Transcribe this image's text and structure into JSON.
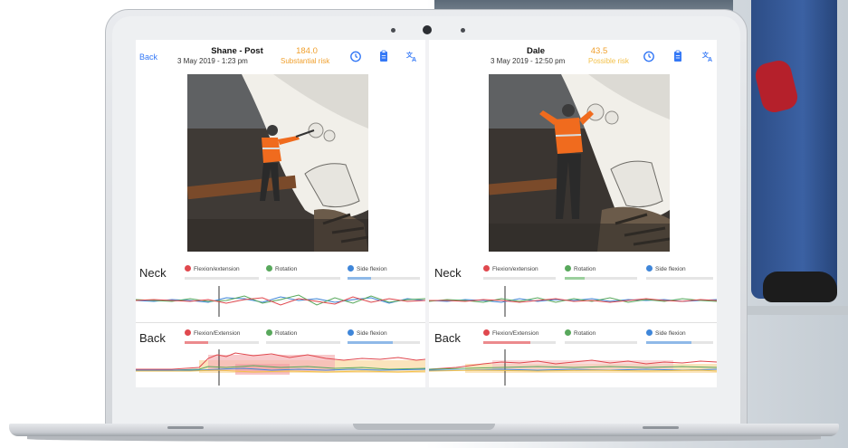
{
  "colors": {
    "accent": "#3478f6",
    "risk_high": "#f0a02e",
    "risk_low": "#f3c14a",
    "flexion": "#e0484e",
    "rotation": "#58a85c",
    "side_flexion": "#3f86d9"
  },
  "left": {
    "back_label": "Back",
    "name": "Shane - Post",
    "date": "3 May 2019 - 1:23 pm",
    "score": "184.0",
    "risk": "Substantial risk",
    "icons": [
      "timer-icon",
      "clipboard-icon",
      "translate-icon"
    ],
    "neck": {
      "title": "Neck",
      "legend": [
        "Flexion/extension",
        "Rotation",
        "Side flexion"
      ]
    },
    "back": {
      "title": "Back",
      "legend": [
        "Flexion/Extension",
        "Rotation",
        "Side flexion"
      ]
    }
  },
  "right": {
    "name": "Dale",
    "date": "3 May 2019 - 12:50 pm",
    "score": "43.5",
    "risk": "Possible risk",
    "icons": [
      "timer-icon",
      "clipboard-icon",
      "translate-icon"
    ],
    "neck": {
      "title": "Neck",
      "legend": [
        "Flexion/extension",
        "Rotation",
        "Side flexion"
      ]
    },
    "back": {
      "title": "Back",
      "legend": [
        "Flexion/Extension",
        "Rotation",
        "Side flexion"
      ]
    }
  }
}
